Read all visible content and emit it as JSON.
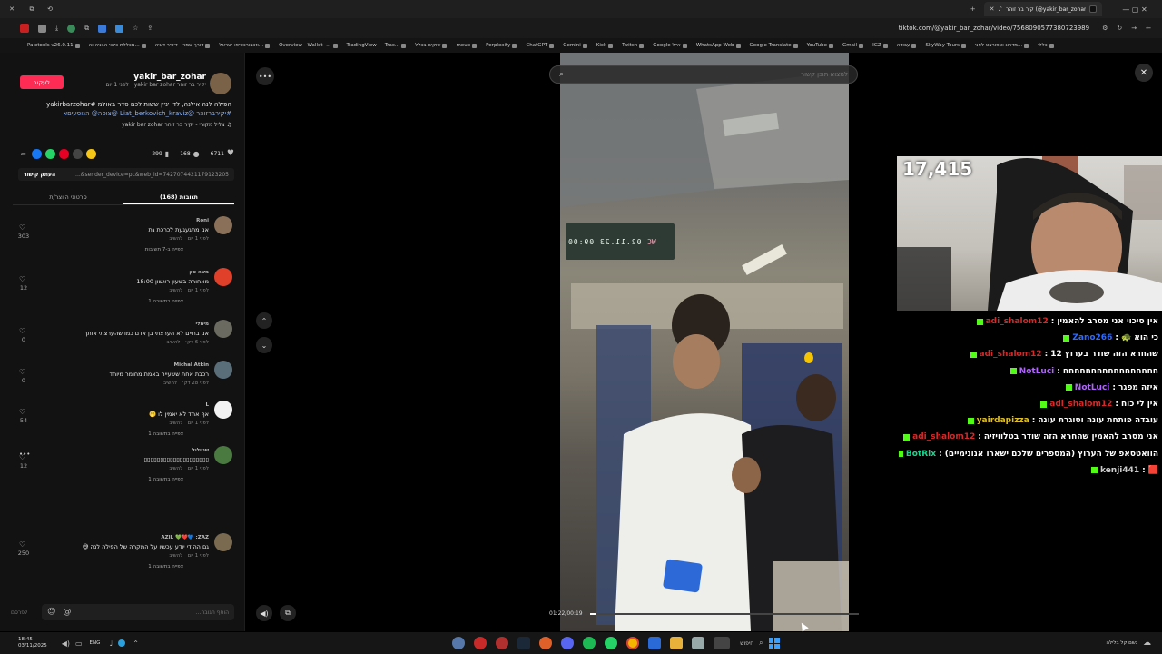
{
  "browser": {
    "tab_title": "קיר בר זוהר (@yakir_bar_zohar) | TikTok",
    "url": "tiktok.com/@yakir_bar_zohar/video/7568090577380723989",
    "bookmarks": [
      "Paletools v26.0.11",
      "מכללת כלכי הבניה וה...",
      "דורך שמר - דיפיר דיגיה",
      "וזכבורכטיפו ישראל...",
      "Overview - Wallet -...",
      "TradingView — Trac...",
      "שוקים בכלל",
      "meup",
      "Perplexity",
      "ChatGPT",
      "Gemini",
      "Kick",
      "Twitch",
      "Google אייל",
      "WhatsApp Web",
      "Google Translate",
      "YouTube",
      "Gmail",
      "IGZ",
      "עבודה",
      "SkyWay Tours",
      "מדרונ וטפורצט לפני...",
      "כללי"
    ]
  },
  "post": {
    "username": "yakir_bar_zohar",
    "meta": "יקיר בר זוהר yakir bar zohar · לפני 1 יום",
    "follow_label": "לעקוב",
    "caption_line1": "הפילה לנה אילנה, לדי יניין ששות לכם סדר באולמ #yakirbarzohar",
    "caption_line2": "#יקירברזוהר @Liat_berkovich_kraviz @צופה@ הנוסעיםא",
    "sound": "♫ צליל מקורי - יקיר בר זוהר yakir bar zohar",
    "likes": "6711",
    "comments": "168",
    "saves": "299",
    "link_text": "...&sender_device=pc&web_id=7427074421179123205",
    "copy_link": "העתק קישור",
    "tab_comments": "תגובות (168)",
    "tab_creator": "סרטוני היוצר/ת",
    "more_label": "•••",
    "add_comment_placeholder": "הוסף תגובה...",
    "post_button": "לפרסם"
  },
  "comments": [
    {
      "user": "Roni",
      "text": "אני מתגעגעת לכרכת גת",
      "time": "לפני 1 יום",
      "reply": "להשיב",
      "likes": "303",
      "thread": "צפייה ב-7 תשובות",
      "avatar": "#8a7058"
    },
    {
      "user": "משה טק",
      "text": "מאחורה בשעון ראשון 18:00",
      "time": "לפני 1 יום",
      "reply": "להשיב",
      "likes": "12",
      "thread": "צפייה בתשובה 1",
      "avatar": "#e0402a"
    },
    {
      "user": "מימלי",
      "text": "אני בחיים לא הערצתי בן אדם כמו שהערצתי אותך",
      "time": "לפני 6 דק׳",
      "reply": "להשיב",
      "likes": "0",
      "thread": "",
      "avatar": "#6a6a60"
    },
    {
      "user": "Michal Atkin",
      "text": "רכבת אחת ששעייה באמת מחומר מיוחד",
      "time": "לפני 28 דק׳",
      "reply": "להשיב",
      "likes": "0",
      "thread": "",
      "avatar": "#5a6e7a"
    },
    {
      "user": "L",
      "text": "אף אחד לא יאמין לו 🫢",
      "time": "לפני 1 יום",
      "reply": "להשיב",
      "likes": "54",
      "thread": "צפייה בתשובה 1",
      "avatar": "#f2f2f2"
    },
    {
      "user": "שניילול",
      "text": "▯▯▯▯▯▯▯▯▯▯▯▯▯▯▯▯▯▯▯▯",
      "time": "לפני 1 יום",
      "reply": "להשיב",
      "likes": "12",
      "thread": "צפייה בתשובה 1",
      "avatar": "#4a7a40"
    },
    {
      "user": "AZIL 💚❤️💙 :ZAZ",
      "text": "גם ההודי יודע עכשיו על המקרה של הפילה לנה 😅",
      "time": "לפני 1 יום",
      "reply": "להשיב",
      "likes": "250",
      "thread": "צפייה בתשובה 1",
      "avatar": "#7a6a50"
    }
  ],
  "player": {
    "search_placeholder": "למצוא תוכן קשור",
    "time": "01:22/00:19",
    "display_left": "02.11.23  09:00",
    "display_right": "WC",
    "progress_fraction": 0.02
  },
  "stream": {
    "viewer_count": "17,415"
  },
  "chat": [
    {
      "user": "adi_shalom12",
      "text": "אין סיכוי אני מסרב להאמין",
      "color": "#d42a2a"
    },
    {
      "user": "Zano266",
      "text": "כי הוא 🐢",
      "color": "#2f6bff"
    },
    {
      "user": "adi_shalom12",
      "text": "שהחרא הזה שודר בערוץ 12",
      "color": "#d42a2a"
    },
    {
      "user": "NotLuci",
      "text": "חחחחחחחחחחחחחחחחח",
      "color": "#b266ff"
    },
    {
      "user": "NotLuci",
      "text": "איזה מפגר",
      "color": "#b266ff"
    },
    {
      "user": "adi_shalom12",
      "text": "אין לי כוח",
      "color": "#d42a2a"
    },
    {
      "user": "yairdapizza",
      "text": "עובדה פותחת עונה וסוגרת עונה",
      "color": "#e0c020"
    },
    {
      "user": "adi_shalom12",
      "text": "אני מסרב להאמין שהחרא הזה שודר בטלוויזיה",
      "color": "#d42a2a"
    },
    {
      "user": "BotRix",
      "text": "הוואטסאפ של הערוץ (המספרים שלכם ישארו אנונימיים)",
      "color": "#19d68f"
    },
    {
      "user": "kenji441",
      "text": "🟥",
      "color": "#cccccc"
    }
  ],
  "taskbar": {
    "time": "18:45",
    "date": "03/11/2025",
    "lang": "ENG",
    "search": "חיפוש",
    "weather": "גשם קל בלילה"
  }
}
